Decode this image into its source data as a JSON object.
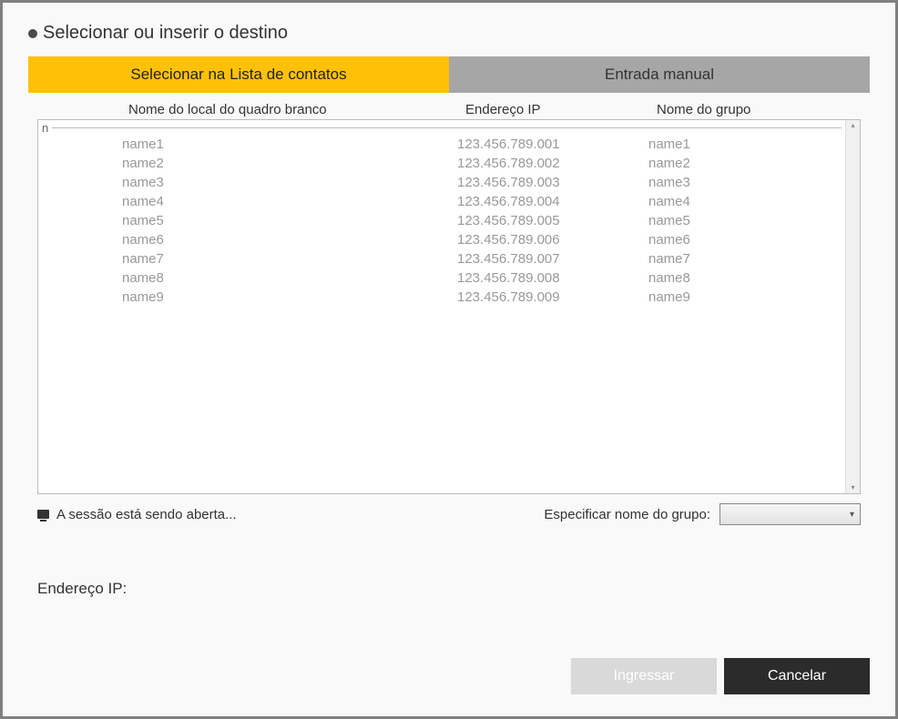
{
  "title": "Selecionar ou inserir o destino",
  "tabs": {
    "contacts": "Selecionar na Lista de contatos",
    "manual": "Entrada manual"
  },
  "columns": {
    "name": "Nome do local do quadro branco",
    "ip": "Endereço IP",
    "group": "Nome do grupo"
  },
  "group_marker": "n",
  "rows": [
    {
      "name": "name1",
      "ip": "123.456.789.001",
      "group": "name1"
    },
    {
      "name": "name2",
      "ip": "123.456.789.002",
      "group": "name2"
    },
    {
      "name": "name3",
      "ip": "123.456.789.003",
      "group": "name3"
    },
    {
      "name": "name4",
      "ip": "123.456.789.004",
      "group": "name4"
    },
    {
      "name": "name5",
      "ip": "123.456.789.005",
      "group": "name5"
    },
    {
      "name": "name6",
      "ip": "123.456.789.006",
      "group": "name6"
    },
    {
      "name": "name7",
      "ip": "123.456.789.007",
      "group": "name7"
    },
    {
      "name": "name8",
      "ip": "123.456.789.008",
      "group": "name8"
    },
    {
      "name": "name9",
      "ip": "123.456.789.009",
      "group": "name9"
    }
  ],
  "status": "A sessão está sendo aberta...",
  "group_spec_label": "Especificar nome do grupo:",
  "group_spec_value": "",
  "ip_label": "Endereço IP:",
  "ip_value": "",
  "buttons": {
    "join": "Ingressar",
    "cancel": "Cancelar"
  }
}
